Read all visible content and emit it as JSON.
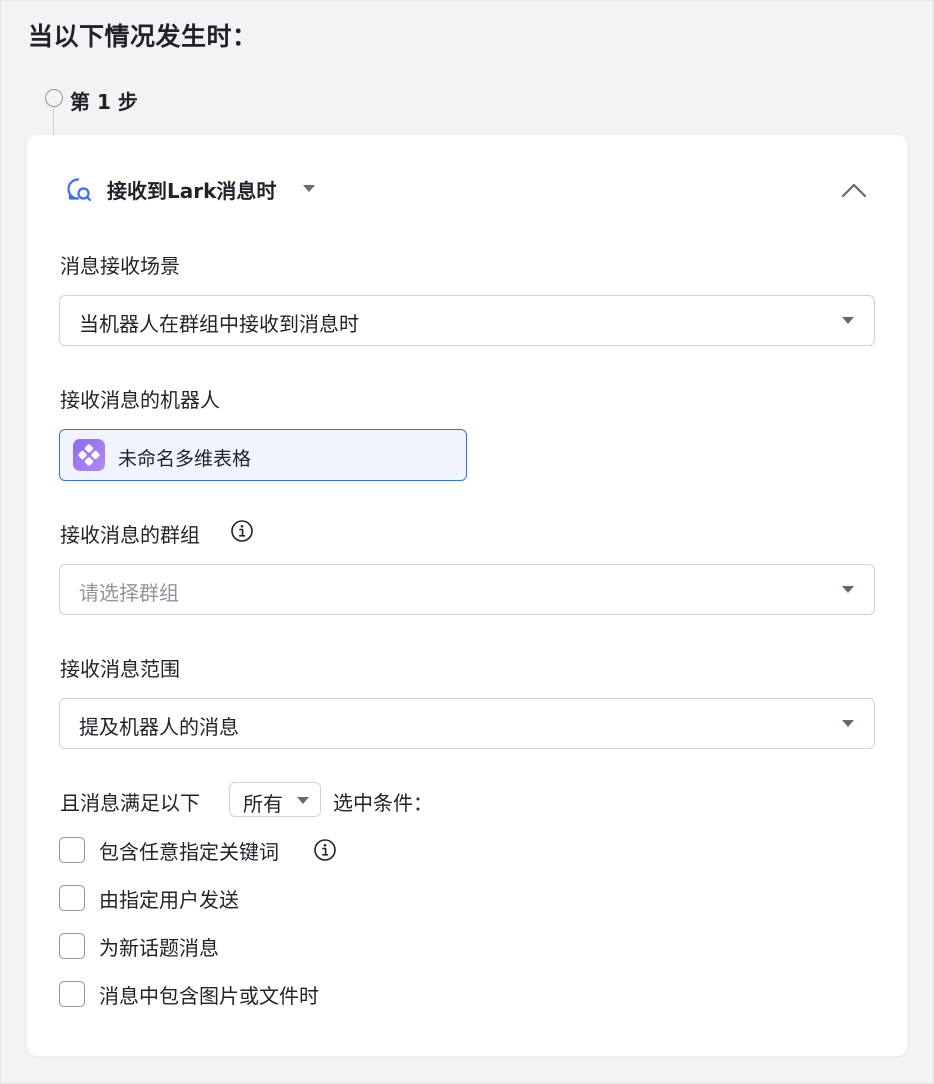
{
  "page": {
    "heading": "当以下情况发生时：",
    "step_label": "第 1 步"
  },
  "trigger": {
    "title": "接收到Lark消息时",
    "icon": "message-bubble-icon",
    "collapse_icon": "chevron-up-icon",
    "accent": "#3370ff"
  },
  "fields": {
    "scene_label": "消息接收场景",
    "scene_value": "当机器人在群组中接收到消息时",
    "bot_label": "接收消息的机器人",
    "bot_name": "未命名多维表格",
    "bot_avatar_color": "#9b78f2",
    "group_label": "接收消息的群组",
    "group_placeholder": "请选择群组",
    "range_label": "接收消息范围",
    "range_value": "提及机器人的消息"
  },
  "conditions": {
    "prefix": "且消息满足以下",
    "mode": "所有",
    "suffix": "选中条件：",
    "options": [
      {
        "label": "包含任意指定关键词",
        "checked": false,
        "has_info": true
      },
      {
        "label": "由指定用户发送",
        "checked": false,
        "has_info": false
      },
      {
        "label": "为新话题消息",
        "checked": false,
        "has_info": false
      },
      {
        "label": "消息中包含图片或文件时",
        "checked": false,
        "has_info": false
      }
    ]
  }
}
